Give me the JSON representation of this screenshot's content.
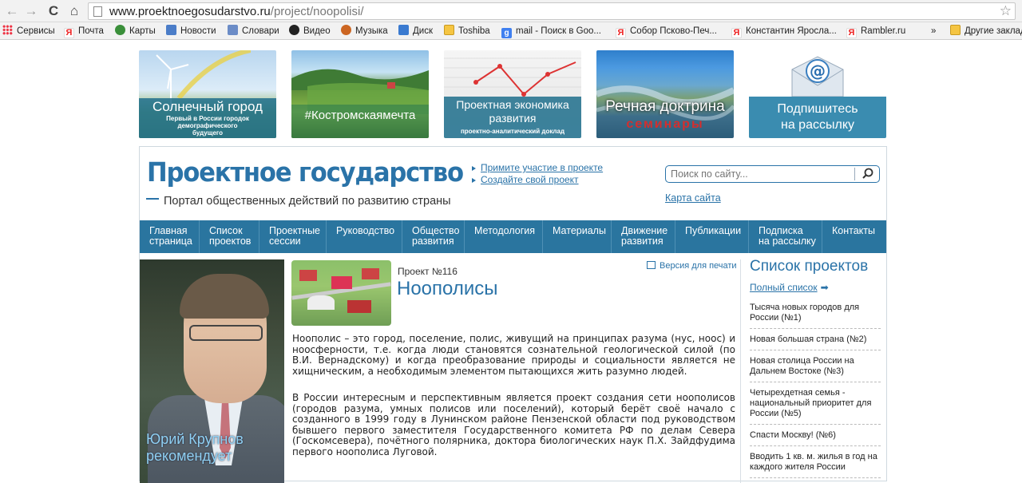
{
  "browser": {
    "url_host": "www.proektnoegosudarstvo.ru",
    "url_path": "/project/noopolisi/"
  },
  "bookmarks": [
    {
      "label": "Сервисы",
      "icon": "apps-grid-icon"
    },
    {
      "label": "Почта",
      "icon": "yandex-icon"
    },
    {
      "label": "Карты",
      "icon": "maps-icon"
    },
    {
      "label": "Новости",
      "icon": "news-icon"
    },
    {
      "label": "Словари",
      "icon": "dictionary-icon"
    },
    {
      "label": "Видео",
      "icon": "video-icon"
    },
    {
      "label": "Музыка",
      "icon": "music-icon"
    },
    {
      "label": "Диск",
      "icon": "disk-icon"
    },
    {
      "label": "Toshiba",
      "icon": "folder-icon"
    },
    {
      "label": "mail - Поиск в Goo...",
      "icon": "google-icon"
    },
    {
      "label": "Собор Псково-Печ...",
      "icon": "yandex-icon"
    },
    {
      "label": "Константин Яросла...",
      "icon": "yandex-icon"
    },
    {
      "label": "Rambler.ru",
      "icon": "yandex-icon"
    },
    {
      "label": "»",
      "icon": ""
    },
    {
      "label": "Другие закладки",
      "icon": "folder-icon"
    }
  ],
  "banners": [
    {
      "title": "Солнечный город",
      "subtitle": "Первый в России городок демографического будущего"
    },
    {
      "title": "#Костромскаямечта",
      "subtitle": ""
    },
    {
      "title": "Проектная экономика развития",
      "subtitle": "проектно-аналитический доклад"
    },
    {
      "title": "Речная доктрина",
      "subtitle": "семинары"
    },
    {
      "title": "Подпишитесь на рассылку",
      "subtitle": ""
    }
  ],
  "header": {
    "logo_title": "Проектное государство",
    "logo_subtitle": "Портал общественных действий по развитию страны",
    "quick_links": [
      "Примите участие в проекте",
      "Создайте свой проект"
    ],
    "search_placeholder": "Поиск по сайту...",
    "sitemap": "Карта сайта"
  },
  "menu": [
    "Главная\nстраница",
    "Список\nпроектов",
    "Проектные\nсессии",
    "Руководство",
    "Общество\nразвития",
    "Методология",
    "Материалы",
    "Движение\nразвития",
    "Публикации",
    "Подписка\nна рассылку",
    "Контакты"
  ],
  "left": {
    "caption": "Юрий Крупнов рекомендует"
  },
  "project": {
    "number": "Проект №116",
    "title": "Ноополисы",
    "print": "Версия для печати",
    "p1": "Ноополис – это город, поселение, полис, живущий на принципах разума (нус, ноос) и ноосферности, т.е. когда люди становятся сознательной геологической силой (по В.И. Вернадскому) и когда преобразование природы и социальности является не хищническим, а необходимым элементом пытающихся жить разумно людей.",
    "p2": "В России интересным и перспективным является проект создания сети ноополисов (городов разума, умных полисов или поселений), который берёт своё начало с созданного в 1999 году в Лунинском районе Пензенской области под руководством бывшего первого заместителя Государственного комитета РФ по делам Севера (Госкомсевера), почётного полярника, доктора биологических наук П.Х. Зайдфудима первого ноополиса Луговой."
  },
  "sidebar": {
    "title": "Список проектов",
    "full_list": "Полный список",
    "items": [
      "Тысяча новых городов для России (№1)",
      "Новая большая страна (№2)",
      "Новая столица России на Дальнем Востоке (№3)",
      "Четырехдетная семья - национальный приоритет для России (№5)",
      "Спасти Москву! (№6)",
      "Вводить 1 кв. м. жилья в год на каждого жителя России"
    ]
  }
}
